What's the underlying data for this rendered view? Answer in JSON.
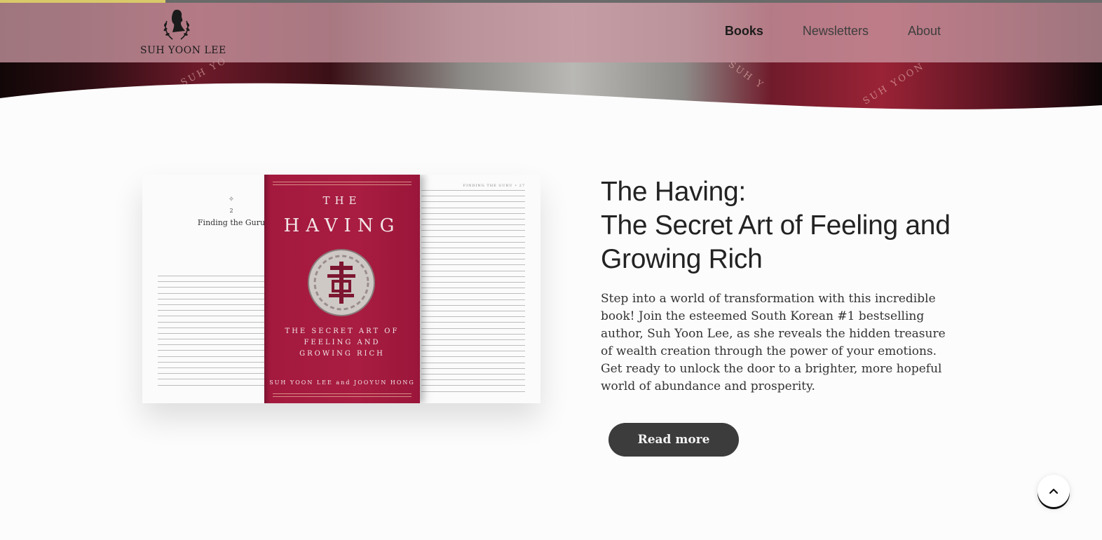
{
  "site": {
    "logo_text": "SUH YOON LEE",
    "progress_percent": 15
  },
  "nav": {
    "items": [
      {
        "label": "Books",
        "active": true
      },
      {
        "label": "Newsletters",
        "active": false
      },
      {
        "label": "About",
        "active": false
      }
    ]
  },
  "hero": {
    "book_edge_left": "SUH YO",
    "book_edge_right": "SUH YOON",
    "book_edge_mid": "SUH Y"
  },
  "book_image": {
    "chapter_number": "2",
    "chapter_title": "Finding the Guru",
    "running_head": "FINDING THE GURU • 27",
    "cover": {
      "the": "THE",
      "having": "HAVING",
      "subtitle_line1": "THE SECRET ART OF",
      "subtitle_line2": "FEELING AND",
      "subtitle_line3": "GROWING RICH",
      "authors": "SUH YOON LEE and JOOYUN HONG"
    }
  },
  "book": {
    "title_line1": "The Having:",
    "title_line2": "The Secret Art of Feeling and",
    "title_line3": "Growing Rich",
    "description": "Step into a world of transformation with this incredible book! Join the esteemed South Korean #1 bestselling author, Suh Yoon Lee, as she reveals the hidden treasure of wealth creation through the power of your emotions. Get ready to unlock the door to a brighter, more hopeful world of abundance and prosperity.",
    "cta_label": "Read more"
  },
  "colors": {
    "header_bg": "#c896a0",
    "cover": "#a81d41",
    "button": "#3c3c3c",
    "progress": "#d9c96a"
  },
  "icons": {
    "logo": "silhouette-laurel-logo",
    "scroll_top": "chevron-up-icon"
  }
}
